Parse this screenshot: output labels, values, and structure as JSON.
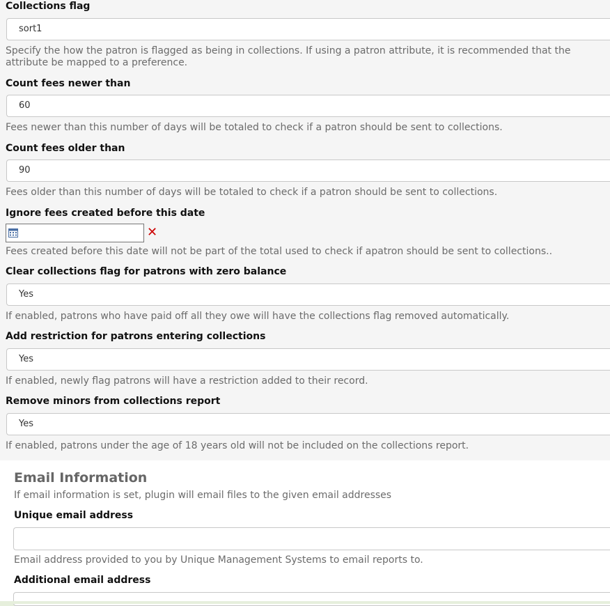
{
  "collections_flag": {
    "label": "Collections flag",
    "value": "sort1",
    "help": "Specify the how the patron is flagged as being in collections. If using a patron attribute, it is recommended that the attribute be mapped to a preference."
  },
  "count_fees_newer": {
    "label": "Count fees newer than",
    "value": "60",
    "help": "Fees newer than this number of days will be totaled to check if a patron should be sent to collections."
  },
  "count_fees_older": {
    "label": "Count fees older than",
    "value": "90",
    "help": "Fees older than this number of days will be totaled to check if a patron should be sent to collections."
  },
  "ignore_fees_before": {
    "label": "Ignore fees created before this date",
    "value": "",
    "clear_glyph": "✕",
    "help": "Fees created before this date will not be part of the total used to check if apatron should be sent to collections.."
  },
  "clear_flag_zero_balance": {
    "label": "Clear collections flag for patrons with zero balance",
    "value": "Yes",
    "help": "If enabled, patrons who have paid off all they owe will have the collections flag removed automatically."
  },
  "add_restriction": {
    "label": "Add restriction for patrons entering collections",
    "value": "Yes",
    "help": "If enabled, newly flag patrons will have a restriction added to their record."
  },
  "remove_minors": {
    "label": "Remove minors from collections report",
    "value": "Yes",
    "help": "If enabled, patrons under the age of 18 years old will not be included on the collections report."
  },
  "email_section": {
    "title": "Email Information",
    "description": "If email information is set, plugin will email files to the given email addresses",
    "unique_email": {
      "label": "Unique email address",
      "value": "",
      "help": "Email address provided to you by Unique Management Systems to email reports to."
    },
    "additional_email": {
      "label": "Additional email address",
      "value": ""
    }
  },
  "colors": {
    "help_text": "#6b6b6b",
    "clear_icon": "#cc0000",
    "section_title": "#666666"
  },
  "icons": {
    "calendar": "calendar-icon",
    "clear": "clear-x-icon"
  }
}
